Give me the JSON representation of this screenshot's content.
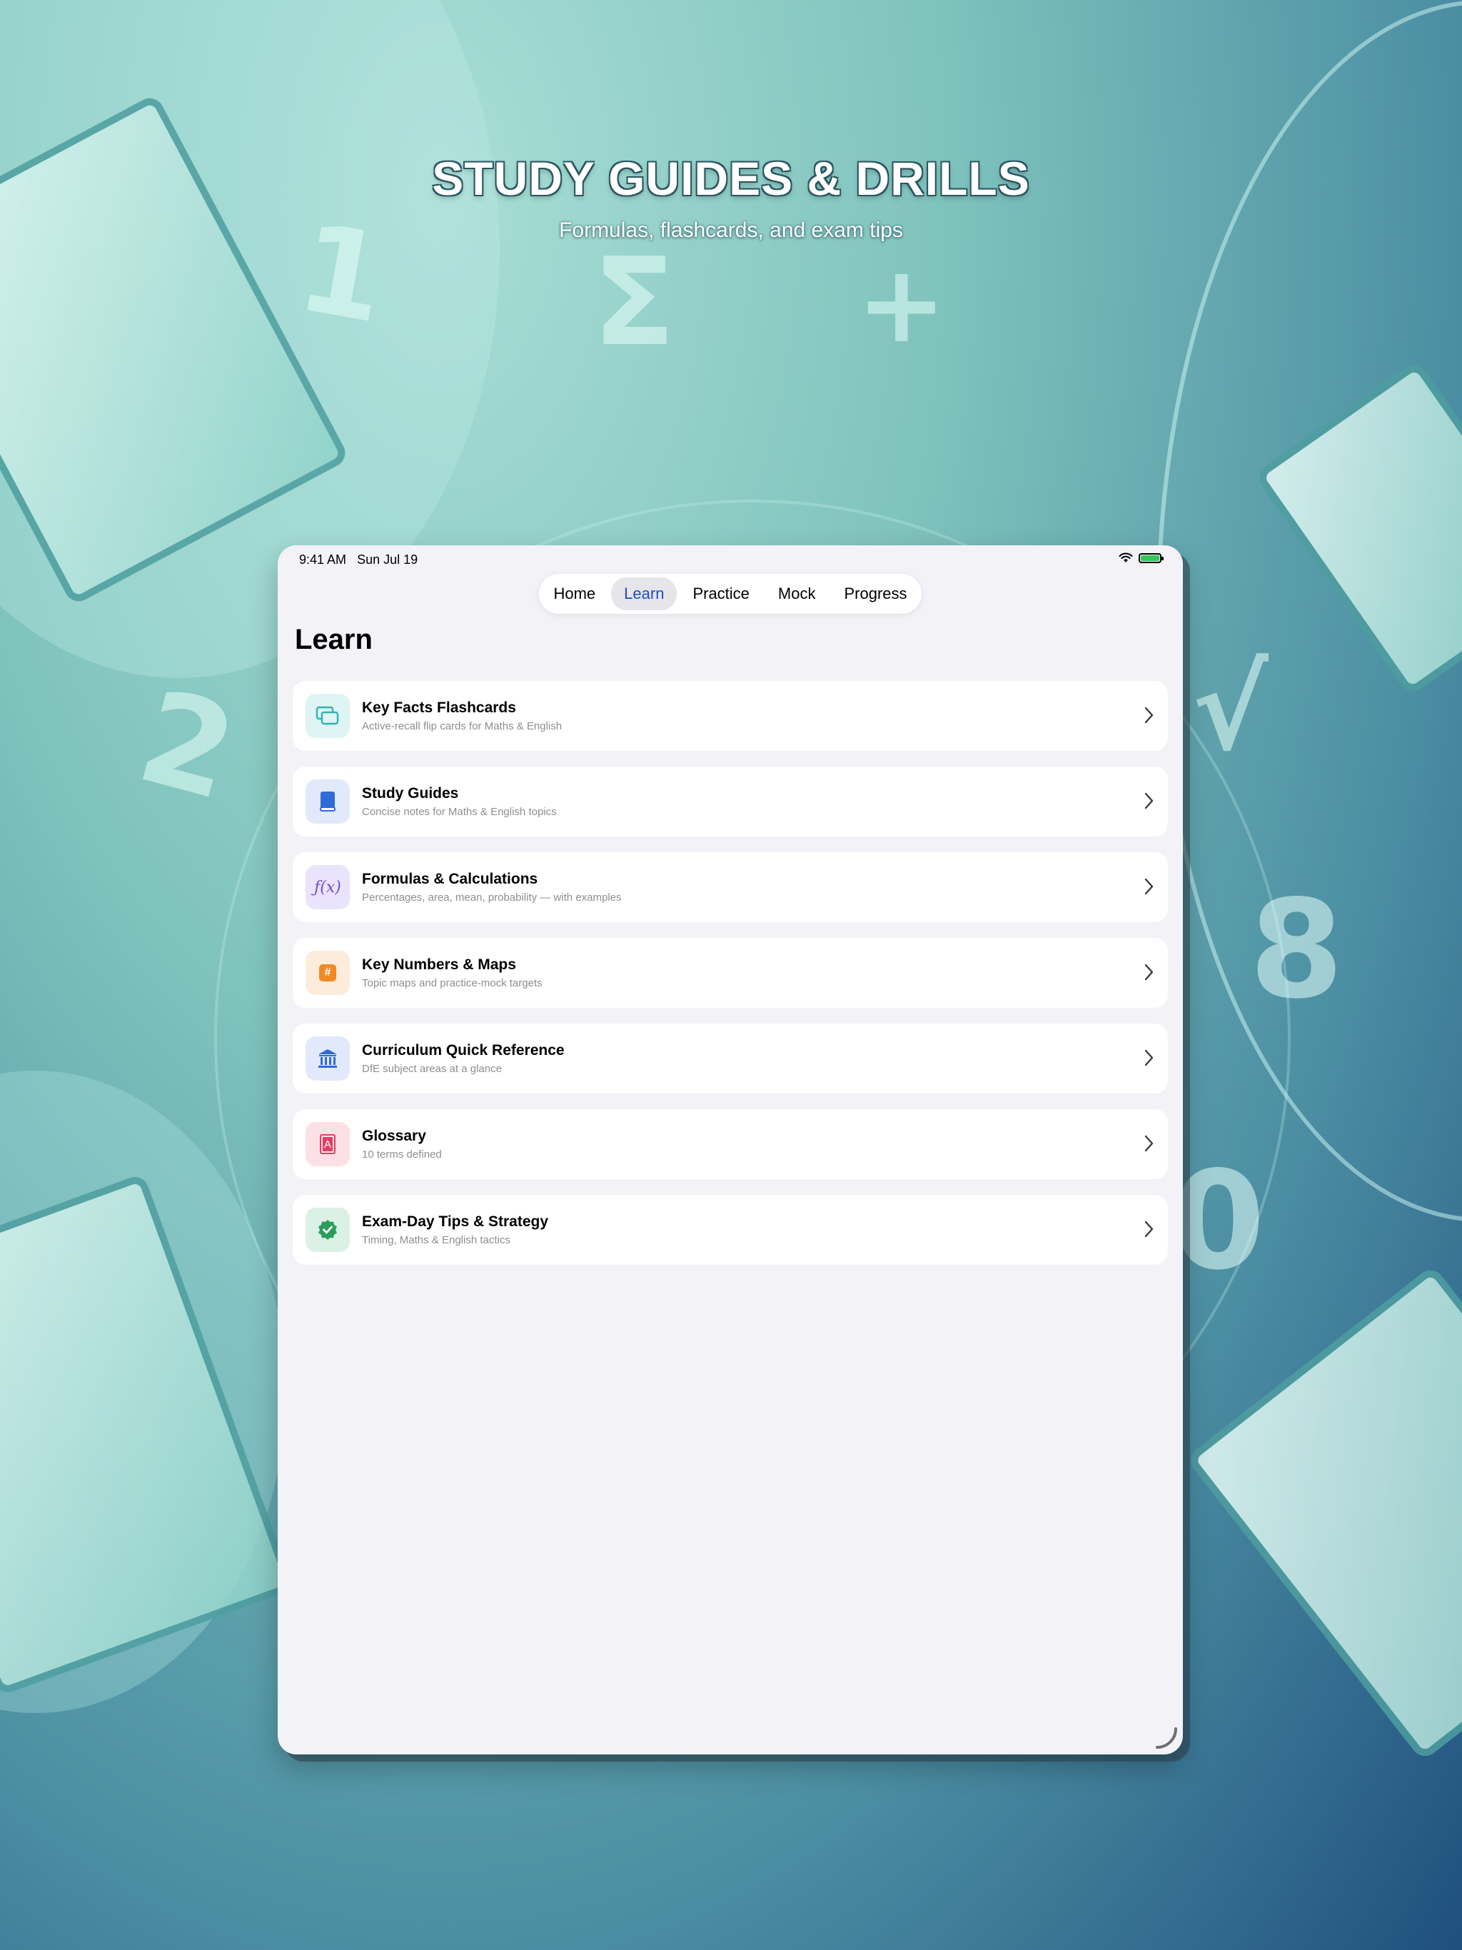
{
  "hero": {
    "title": "STUDY GUIDES & DRILLS",
    "subtitle": "Formulas, flashcards, and exam tips"
  },
  "status_bar": {
    "time": "9:41 AM",
    "date": "Sun Jul 19"
  },
  "tabs": [
    {
      "label": "Home",
      "active": false
    },
    {
      "label": "Learn",
      "active": true
    },
    {
      "label": "Practice",
      "active": false
    },
    {
      "label": "Mock",
      "active": false
    },
    {
      "label": "Progress",
      "active": false
    }
  ],
  "page": {
    "title": "Learn"
  },
  "items": [
    {
      "title": "Key Facts Flashcards",
      "subtitle": "Active-recall flip cards for Maths & English",
      "icon": "flashcards-icon",
      "icon_bg": "#dff4f4",
      "icon_color": "#2bb5b0"
    },
    {
      "title": "Study Guides",
      "subtitle": "Concise notes for Maths & English topics",
      "icon": "book-icon",
      "icon_bg": "#e1e9fb",
      "icon_color": "#2f6bd6"
    },
    {
      "title": "Formulas & Calculations",
      "subtitle": "Percentages, area, mean, probability — with examples",
      "icon": "function-icon",
      "icon_bg": "#e9e4fb",
      "icon_color": "#6a4fd1",
      "icon_text": "ƒ(x)"
    },
    {
      "title": "Key Numbers & Maps",
      "subtitle": "Topic maps and practice-mock targets",
      "icon": "number-sign-icon",
      "icon_bg": "#fdebdc",
      "icon_color": "#f08a24",
      "icon_text": "#"
    },
    {
      "title": "Curriculum Quick Reference",
      "subtitle": "DfE subject areas at a glance",
      "icon": "building-columns-icon",
      "icon_bg": "#e1e9fb",
      "icon_color": "#2f6bd6"
    },
    {
      "title": "Glossary",
      "subtitle": "10 terms defined",
      "icon": "dictionary-icon",
      "icon_bg": "#fbe1e6",
      "icon_color": "#e53e63",
      "icon_text": "A"
    },
    {
      "title": "Exam-Day Tips & Strategy",
      "subtitle": "Timing, Maths & English tactics",
      "icon": "checkmark-seal-icon",
      "icon_bg": "#dcf1e6",
      "icon_color": "#2a9e5c"
    }
  ],
  "background_glyphs": [
    "1",
    "Σ",
    "+",
    "2",
    "√",
    "8",
    "0"
  ],
  "colors": {
    "accent": "#1d4fbf",
    "battery": "#34c759",
    "screen_bg": "#f2f2f7"
  }
}
